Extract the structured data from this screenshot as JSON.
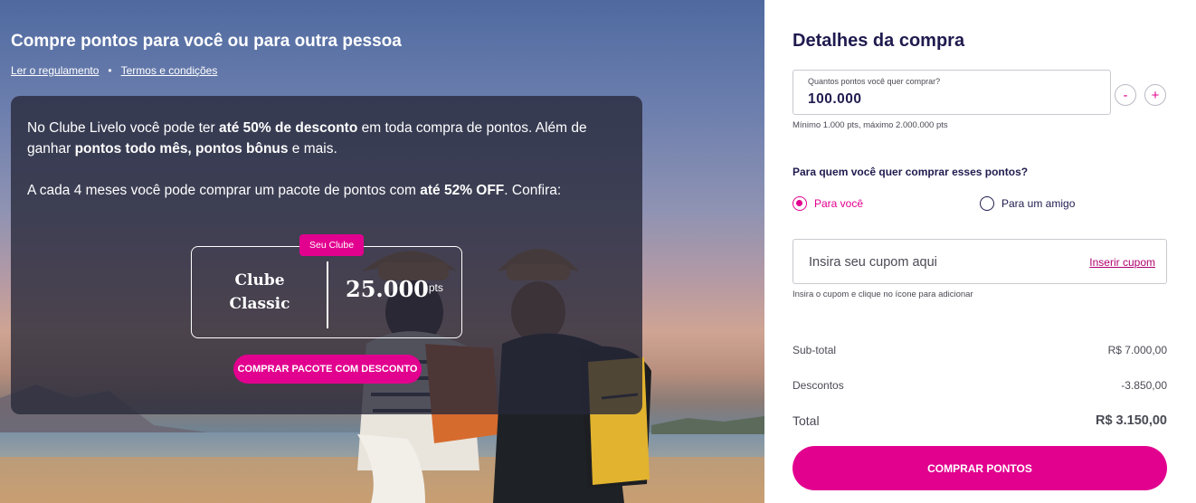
{
  "hero": {
    "title": "Compre pontos para você ou para outra pessoa",
    "link_regulamento": "Ler o regulamento",
    "separator": "•",
    "link_termos": "Termos e condições",
    "card": {
      "p1_a": "No Clube Livelo você pode ter ",
      "p1_b": "até 50% de desconto",
      "p1_c": " em toda compra de pontos. Além de ganhar ",
      "p1_d": "pontos todo mês, pontos bônus",
      "p1_e": " e mais.",
      "p2_a": "A cada 4 meses você pode comprar um pacote de pontos com ",
      "p2_b": "até 52% OFF",
      "p2_c": ". Confira:",
      "tag": "Seu Clube",
      "club_line1": "Clube",
      "club_line2": "Classic",
      "club_points": "25.000",
      "club_unit": "pts",
      "button": "COMPRAR PACOTE COM DESCONTO"
    }
  },
  "panel": {
    "title": "Detalhes da compra",
    "quantity": {
      "label": "Quantos pontos você quer comprar?",
      "value": "100.000",
      "minus": "-",
      "plus": "+",
      "hint": "Mínimo 1.000 pts, máximo 2.000.000 pts"
    },
    "recipient": {
      "question": "Para quem você quer comprar esses pontos?",
      "option_you": "Para você",
      "option_friend": "Para um amigo",
      "selected": "Para você"
    },
    "coupon": {
      "placeholder": "Insira seu cupom aqui",
      "link": "Inserir cupom",
      "hint": "Insira o cupom e clique no ícone para adicionar"
    },
    "summary": {
      "subtotal_label": "Sub-total",
      "subtotal_value": "R$ 7.000,00",
      "discount_label": "Descontos",
      "discount_value": "-3.850,00",
      "total_label": "Total",
      "total_value": "R$ 3.150,00"
    },
    "buy_button": "COMPRAR PONTOS"
  },
  "colors": {
    "brand": "#e2008f",
    "title": "#1f1b4f"
  }
}
